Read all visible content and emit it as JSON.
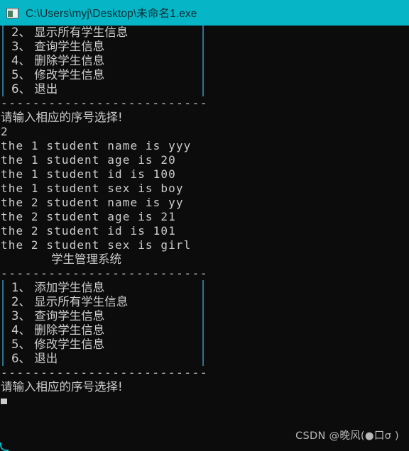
{
  "window": {
    "title": "C:\\Users\\myj\\Desktop\\未命名1.exe",
    "icon": "console-window-icon",
    "titlebar_color": "#06b6c6",
    "console_bg": "#0c0c0c",
    "console_fg": "#cccccc"
  },
  "console": {
    "separator": "--------------------------",
    "vertical_bar": "｜",
    "menu_top_partial": [
      "2、 显示所有学生信息",
      "3、 查询学生信息",
      "4、 删除学生信息",
      "5、 修改学生信息",
      "6、 退出"
    ],
    "prompt_1": "请输入相应的序号选择!",
    "input_echo_1": "2",
    "student_output": [
      "the 1 student name is yyy",
      "the 1 student age is 20",
      "the 1 student id is 100",
      "the 1 student sex is boy",
      "the 2 student name is yy",
      "the 2 student age is 21",
      "the 2 student id is 101",
      "the 2 student sex is girl"
    ],
    "menu_title": "学生管理系统",
    "menu_items": [
      "1、 添加学生信息",
      "2、 显示所有学生信息",
      "3、 查询学生信息",
      "4、 删除学生信息",
      "5、 修改学生信息",
      "6、 退出"
    ],
    "prompt_2": "请输入相应的序号选择!",
    "cursor": "block-cursor"
  },
  "watermark": {
    "text": "CSDN @晚风(●口σ )"
  }
}
